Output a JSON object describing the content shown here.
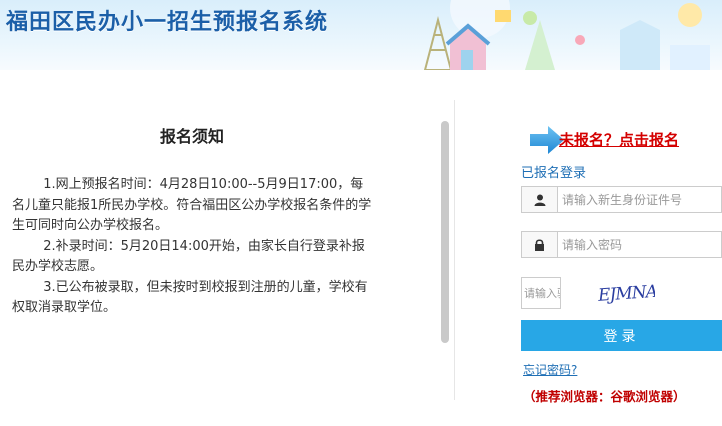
{
  "header": {
    "title": "福田区民办小一招生预报名系统"
  },
  "notice": {
    "title": "报名须知",
    "paragraphs": [
      "1.网上预报名时间：4月28日10:00--5月9日17:00，每名儿童只能报1所民办学校。符合福田区公办学校报名条件的学生可同时向公办学校报名。",
      "2.补录时间：5月20日14:00开始，由家长自行登录补报民办学校志愿。",
      "3.已公布被录取，但未按时到校报到注册的儿童，学校有权取消录取学位。"
    ]
  },
  "login": {
    "register_link": "未报名？点击报名",
    "section_label": "已报名登录",
    "id_placeholder": "请输入新生身份证件号",
    "password_placeholder": "请输入密码",
    "captcha_placeholder": "请输入验证码",
    "captcha_text": "EJMNA",
    "login_button": "登录",
    "forgot_password": "忘记密码?",
    "recommend_browser": "（推荐浏览器：谷歌浏览器）"
  },
  "colors": {
    "title_blue": "#1b5fa8",
    "link_red": "#d40000",
    "button_blue": "#28a7e6",
    "label_blue": "#1f6fb5"
  },
  "icons": {
    "user": "user-icon",
    "lock": "lock-icon",
    "arrow": "arrow-right-icon"
  }
}
